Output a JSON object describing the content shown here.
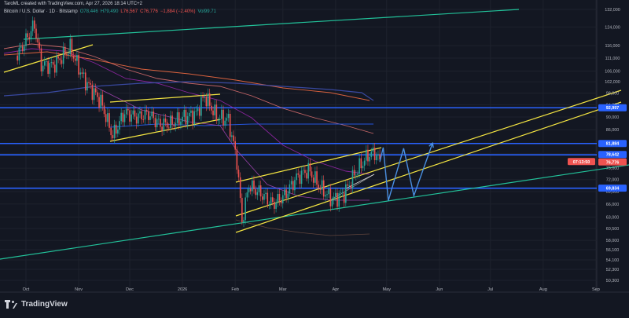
{
  "header": {
    "created_line": "TaroML created with TradingView.com, Apr 27, 2026 18:14 UTC+2",
    "symbol_line": "Bitcoin / U.S. Dollar · 1D · Bitstamp",
    "open": "O78,446",
    "high": "H79,490",
    "low": "L76,567",
    "close": "C76,776",
    "change": "−1,884 (−2.40%)",
    "volume": "Vol99.71"
  },
  "branding": {
    "name": "TradingView"
  },
  "colors": {
    "background": "#131722",
    "bull": "#26a69a",
    "bear": "#ef5350",
    "support_resistance": "#2962ff",
    "channel": "#f5e642",
    "projection": "#4a90e2",
    "trendline": "#22c29a"
  },
  "chart_data": {
    "type": "candlestick",
    "x_tick_labels": [
      "Oct",
      "Nov",
      "Dec",
      "2026",
      "Feb",
      "Mar",
      "Apr",
      "May",
      "Jun",
      "Jul",
      "Aug",
      "Sep"
    ],
    "y_axis": {
      "scale": "log",
      "range": [
        50300,
        132500
      ],
      "tick_labels": [
        "132,000",
        "124,000",
        "116,000",
        "111,000",
        "106,000",
        "102,000",
        "98,000",
        "94,000",
        "90,000",
        "86,000",
        "82,000",
        "79,000",
        "75,000",
        "72,000",
        "69,000",
        "66,000",
        "63,000",
        "60,500",
        "58,000",
        "56,100",
        "54,100",
        "52,300",
        "50,300"
      ]
    },
    "price_labels": [
      {
        "text": "92,997",
        "value": 92997,
        "color": "#2962ff"
      },
      {
        "text": "81,884",
        "value": 81884,
        "color": "#2962ff"
      },
      {
        "text": "78,642",
        "value": 78642,
        "color": "#2962ff"
      },
      {
        "text": "76,776",
        "value": 76776,
        "color": "#ef5350"
      },
      {
        "text": "07:13:50",
        "value": 76776,
        "color": "#ef5350"
      },
      {
        "text": "69,834",
        "value": 69834,
        "color": "#2962ff"
      }
    ],
    "horizontal_levels": [
      92997,
      81884,
      78642,
      69834
    ],
    "price_path": [
      [
        "2025-09-26",
        112000
      ],
      [
        "2025-10-03",
        121000
      ],
      [
        "2025-10-06",
        125000
      ],
      [
        "2025-10-10",
        108500
      ],
      [
        "2025-10-17",
        108000
      ],
      [
        "2025-10-27",
        115000
      ],
      [
        "2025-11-04",
        103000
      ],
      [
        "2025-11-14",
        95000
      ],
      [
        "2025-11-21",
        84000
      ],
      [
        "2025-11-28",
        91500
      ],
      [
        "2025-12-05",
        90000
      ],
      [
        "2025-12-12",
        91000
      ],
      [
        "2025-12-19",
        87500
      ],
      [
        "2025-12-26",
        88000
      ],
      [
        "2026-01-02",
        90000
      ],
      [
        "2026-01-09",
        91000
      ],
      [
        "2026-01-14",
        97000
      ],
      [
        "2026-01-21",
        90000
      ],
      [
        "2026-01-28",
        89000
      ],
      [
        "2026-02-02",
        77000
      ],
      [
        "2026-02-05",
        62000
      ],
      [
        "2026-02-09",
        70500
      ],
      [
        "2026-02-16",
        68500
      ],
      [
        "2026-02-23",
        66000
      ],
      [
        "2026-03-02",
        68000
      ],
      [
        "2026-03-09",
        72500
      ],
      [
        "2026-03-16",
        74500
      ],
      [
        "2026-03-23",
        70000
      ],
      [
        "2026-03-30",
        67000
      ],
      [
        "2026-04-06",
        68500
      ],
      [
        "2026-04-13",
        74000
      ],
      [
        "2026-04-20",
        78500
      ],
      [
        "2026-04-24",
        79300
      ],
      [
        "2026-04-27",
        76776
      ]
    ],
    "projection_path": [
      [
        "2026-04-27",
        76776
      ],
      [
        "2026-04-29",
        80700
      ],
      [
        "2026-05-02",
        66800
      ],
      [
        "2026-05-11",
        80500
      ],
      [
        "2026-05-17",
        68000
      ],
      [
        "2026-05-28",
        82000
      ]
    ]
  }
}
